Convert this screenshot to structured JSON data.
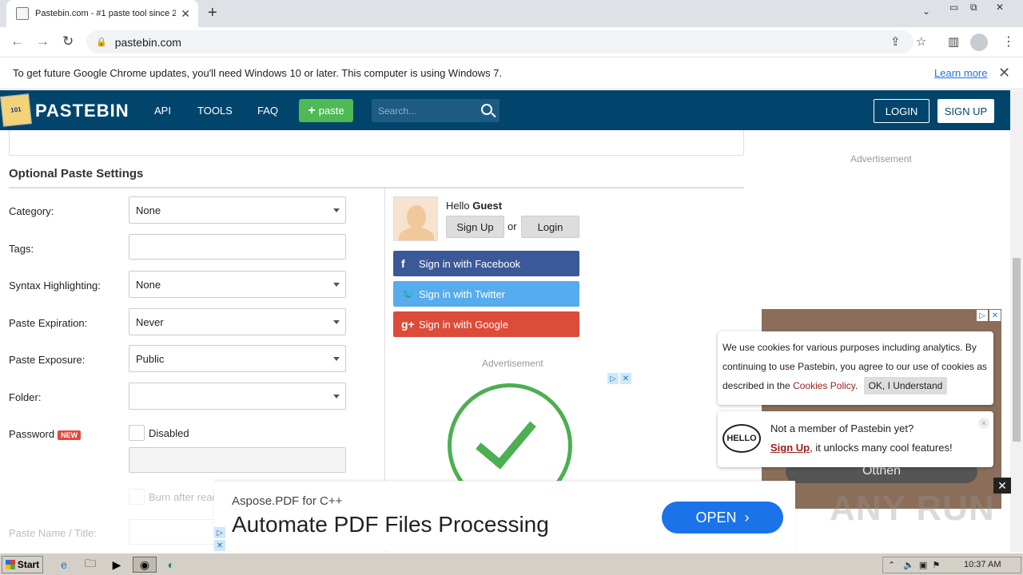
{
  "browser": {
    "tab_title": "Pastebin.com - #1 paste tool since 2",
    "url": "pastebin.com",
    "update_message": "To get future Google Chrome updates, you'll need Windows 10 or later. This computer is using Windows 7.",
    "learn_more": "Learn more"
  },
  "header": {
    "logo_text": "PASTEBIN",
    "logo_badge": "101",
    "nav": [
      "API",
      "TOOLS",
      "FAQ"
    ],
    "paste_label": "paste",
    "search_placeholder": "Search...",
    "login": "LOGIN",
    "signup": "SIGN UP"
  },
  "settings": {
    "title": "Optional Paste Settings",
    "category_label": "Category:",
    "category_value": "None",
    "tags_label": "Tags:",
    "syntax_label": "Syntax Highlighting:",
    "syntax_value": "None",
    "expiration_label": "Paste Expiration:",
    "expiration_value": "Never",
    "exposure_label": "Paste Exposure:",
    "exposure_value": "Public",
    "folder_label": "Folder:",
    "folder_value": "",
    "password_label": "Password",
    "new_badge": "NEW",
    "password_state": "Disabled",
    "burn_label": "Burn after read",
    "paste_name_label": "Paste Name / Title:"
  },
  "guest": {
    "hello": "Hello",
    "guest": "Guest",
    "signup": "Sign Up",
    "or": "or",
    "login": "Login",
    "facebook": "Sign in with Facebook",
    "twitter": "Sign in with Twitter",
    "google": "Sign in with Google"
  },
  "ads": {
    "label": "Advertisement",
    "right_button": "Otthen"
  },
  "cookie": {
    "text_before": "We use cookies for various purposes including analytics. By continuing to use Pastebin, you agree to our use of cookies as described in the",
    "link": "Cookies Policy",
    "period": ".",
    "ok": "OK, I Understand"
  },
  "member": {
    "bubble": "HELLO",
    "line1": "Not a member of Pastebin yet?",
    "signup": "Sign Up",
    "line2_rest": ", it unlocks many cool features!"
  },
  "bottom_ad": {
    "subtitle": "Aspose.PDF for C++",
    "title": "Automate PDF Files Processing",
    "open": "OPEN"
  },
  "watermark": "ANY RUN",
  "taskbar": {
    "start": "Start",
    "clock": "10:37 AM"
  },
  "colors": {
    "header_bg": "#02456c",
    "paste_green": "#4fb956",
    "facebook": "#3b5998",
    "twitter": "#55acee",
    "google": "#dd4b39",
    "link_red": "#a01e1e",
    "open_blue": "#1a73e8"
  }
}
